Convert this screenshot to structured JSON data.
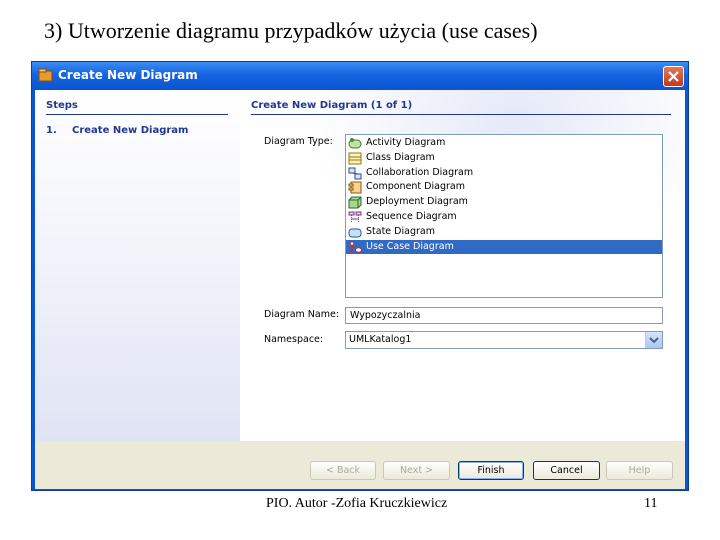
{
  "slide": {
    "title": "3) Utworzenie diagramu przypadków użycia (use cases)",
    "footer": "PIO.  Autor -Zofia Kruczkiewicz",
    "page_number": "11"
  },
  "window": {
    "title": "Create New Diagram",
    "close_icon": "close-icon"
  },
  "steps": {
    "header": "Steps",
    "items": [
      {
        "number": "1.",
        "label": "Create New Diagram"
      }
    ]
  },
  "content": {
    "header": "Create New Diagram (1 of 1)",
    "diagram_type_label": "Diagram Type:",
    "diagram_types": [
      {
        "label": "Activity Diagram",
        "icon": "activity-diagram-icon",
        "selected": false
      },
      {
        "label": "Class Diagram",
        "icon": "class-diagram-icon",
        "selected": false
      },
      {
        "label": "Collaboration Diagram",
        "icon": "collaboration-diagram-icon",
        "selected": false
      },
      {
        "label": "Component Diagram",
        "icon": "component-diagram-icon",
        "selected": false
      },
      {
        "label": "Deployment Diagram",
        "icon": "deployment-diagram-icon",
        "selected": false
      },
      {
        "label": "Sequence Diagram",
        "icon": "sequence-diagram-icon",
        "selected": false
      },
      {
        "label": "State Diagram",
        "icon": "state-diagram-icon",
        "selected": false
      },
      {
        "label": "Use Case Diagram",
        "icon": "use-case-diagram-icon",
        "selected": true
      }
    ],
    "diagram_name_label": "Diagram Name:",
    "diagram_name_value": "Wypozyczalnia",
    "namespace_label": "Namespace:",
    "namespace_value": "UMLKatalog1"
  },
  "buttons": {
    "back": "< Back",
    "next": "Next >",
    "finish": "Finish",
    "cancel": "Cancel",
    "help": "Help"
  },
  "colors": {
    "titlebar": "#0a55d0",
    "selection": "#316ac5",
    "step_text": "#22378f"
  }
}
